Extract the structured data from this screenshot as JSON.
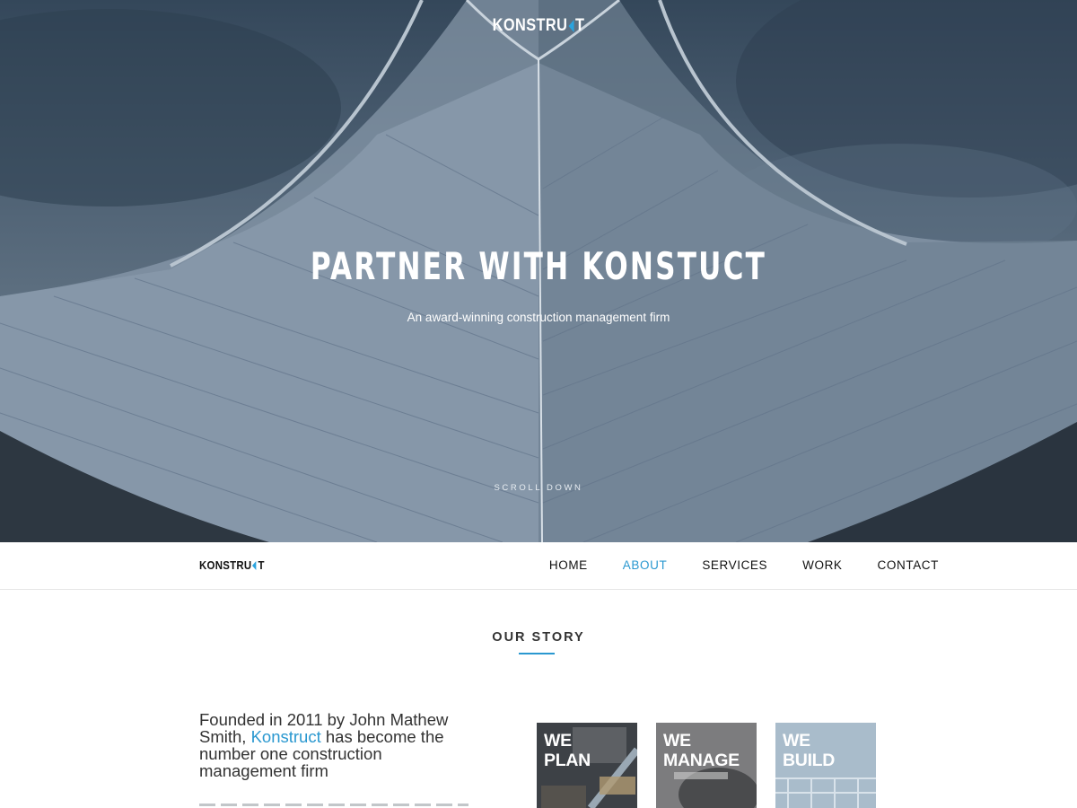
{
  "brand": {
    "name_left": "KONSTRU",
    "name_right": "T",
    "accent_color": "#2aa3de"
  },
  "hero": {
    "title": "PARTNER WITH KONSTUCT",
    "subtitle": "An award-winning construction management firm",
    "scroll_label": "SCROLL DOWN"
  },
  "nav": {
    "items": [
      {
        "label": "HOME",
        "active": false
      },
      {
        "label": "ABOUT",
        "active": true
      },
      {
        "label": "SERVICES",
        "active": false
      },
      {
        "label": "WORK",
        "active": false
      },
      {
        "label": "CONTACT",
        "active": false
      }
    ],
    "active_color": "#2a98d0"
  },
  "story": {
    "section_title": "OUR STORY",
    "intro_before": "Founded in 2011 by John Mathew Smith, ",
    "intro_brand": "Konstruct",
    "intro_after": " has become the number one construction management firm"
  },
  "tiles": [
    {
      "line1": "WE",
      "line2": "PLAN"
    },
    {
      "line1": "WE",
      "line2": "MANAGE"
    },
    {
      "line1": "WE",
      "line2": "BUILD"
    }
  ]
}
